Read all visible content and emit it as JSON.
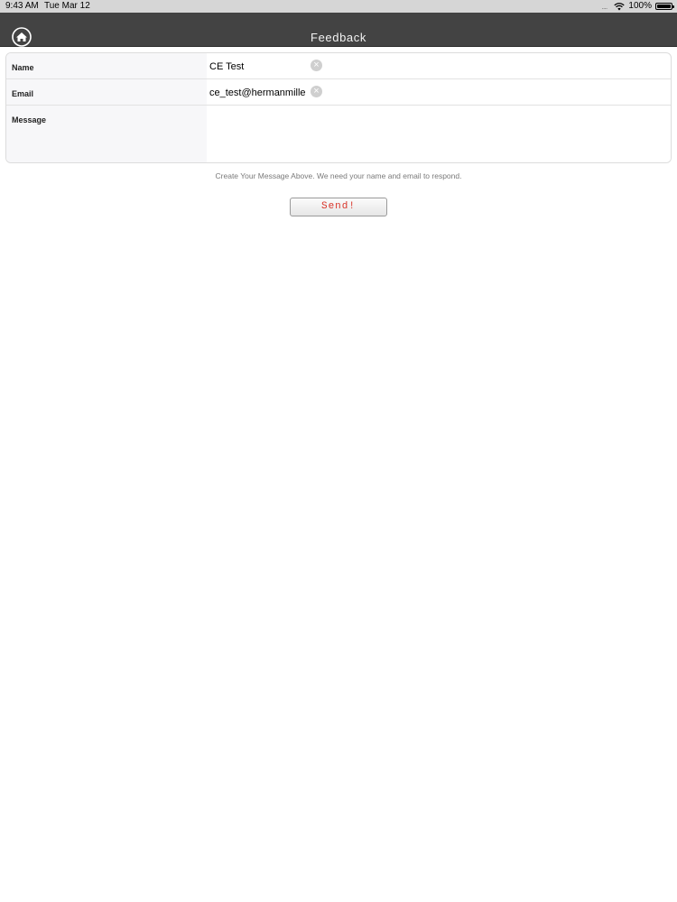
{
  "status_bar": {
    "time": "9:43 AM",
    "date": "Tue Mar 12",
    "signal_dots": "....",
    "battery": "100%",
    "icons": [
      "wifi-icon",
      "battery-icon"
    ]
  },
  "nav": {
    "title": "Feedback",
    "home_icon": "home-icon"
  },
  "form": {
    "name": {
      "label": "Name",
      "value": "CE Test"
    },
    "email": {
      "label": "Email",
      "value": "ce_test@hermanmille"
    },
    "message": {
      "label": "Message",
      "value": ""
    }
  },
  "hint": "Create Your Message Above. We need your name and email to respond.",
  "send_label": "Send!",
  "colors": {
    "nav_bg": "#434343",
    "send_text": "#d9342a"
  }
}
